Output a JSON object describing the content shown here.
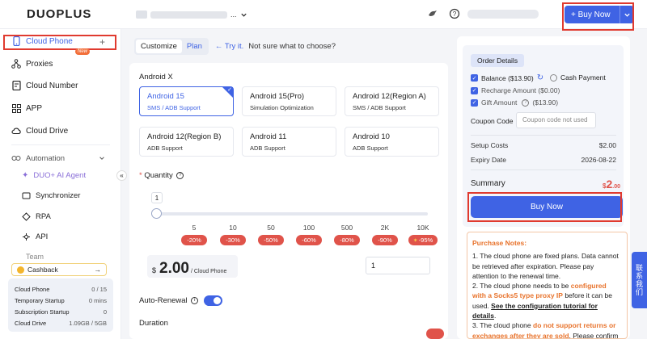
{
  "brand": {
    "logo": "DUOPLUS"
  },
  "header": {
    "account_suffix": "...",
    "buy_now": "+ Buy Now"
  },
  "sidebar": {
    "items": [
      {
        "label": "Cloud Phone",
        "active": true
      },
      {
        "label": "Proxies"
      },
      {
        "label": "Cloud Number",
        "badge": "New"
      },
      {
        "label": "APP"
      },
      {
        "label": "Cloud Drive"
      }
    ],
    "automation": {
      "label": "Automation",
      "items": [
        {
          "label": "DUO+ AI Agent"
        },
        {
          "label": "Synchronizer"
        },
        {
          "label": "RPA"
        },
        {
          "label": "API"
        }
      ]
    },
    "team_label": "Team",
    "cashback": "Cashback",
    "stats": [
      {
        "label": "Cloud Phone",
        "value": "0 / 15"
      },
      {
        "label": "Temporary Startup",
        "value": "0 mins"
      },
      {
        "label": "Subscription Startup",
        "value": "0"
      },
      {
        "label": "Cloud Drive",
        "value": "1.09GB / 5GB"
      }
    ]
  },
  "main": {
    "tabs": [
      {
        "label": "Customize",
        "selected": true
      },
      {
        "label": "Plan"
      }
    ],
    "try_it": "← Try it.",
    "hint": "Not sure what to choose?",
    "section_title": "Android X",
    "options": [
      {
        "title": "Android 15",
        "subtitle": "SMS / ADB Support",
        "selected": true
      },
      {
        "title": "Android 15(Pro)",
        "subtitle": "Simulation Optimization"
      },
      {
        "title": "Android 12(Region A)",
        "subtitle": "SMS / ADB Support"
      },
      {
        "title": "Android 12(Region B)",
        "subtitle": "ADB Support"
      },
      {
        "title": "Android 11",
        "subtitle": "ADB Support"
      },
      {
        "title": "Android 10",
        "subtitle": "ADB Support"
      }
    ],
    "quantity_label": "Quantity",
    "quantity_required": "*",
    "slider_value": "1",
    "ticks": [
      "5",
      "10",
      "50",
      "100",
      "500",
      "2K",
      "10K"
    ],
    "discounts": [
      "-20%",
      "-30%",
      "-50%",
      "-60%",
      "-80%",
      "-90%",
      "-95%"
    ],
    "price": {
      "currency": "$",
      "amount": "2.00",
      "unit": "/ Cloud Phone"
    },
    "quantity_input": "1",
    "auto_renewal": "Auto-Renewal",
    "duration": "Duration"
  },
  "order": {
    "title": "Order Details",
    "balance": "Balance ($13.90)",
    "cash_payment": "Cash Payment",
    "recharge": "Recharge Amount ($0.00)",
    "gift": "Gift Amount",
    "gift_value": "($13.90)",
    "coupon_label": "Coupon Code",
    "coupon_placeholder": "Coupon code not used",
    "setup_label": "Setup Costs",
    "setup_value": "$2.00",
    "expiry_label": "Expiry Date",
    "expiry_value": "2026-08-22",
    "summary_label": "Summary",
    "summary_currency": "$",
    "summary_int": "2",
    "summary_dec": ".00",
    "buy_now": "Buy Now"
  },
  "notes": {
    "title": "Purchase Notes:",
    "n1": "1. The cloud phone are fixed plans. Data cannot be retrieved after expiration. Please pay attention to the renewal time.",
    "n2a": "2. The cloud phone needs to be ",
    "n2b": "configured with a Socks5 type proxy IP",
    "n2c": " before it can be used. ",
    "n2d": "See the configuration tutorial for details",
    "n2e": ".",
    "n3a": "3. The cloud phone ",
    "n3b": "do not support returns or exchanges after they are sold",
    "n3c": ". Please confirm"
  },
  "contact": "联系我们"
}
